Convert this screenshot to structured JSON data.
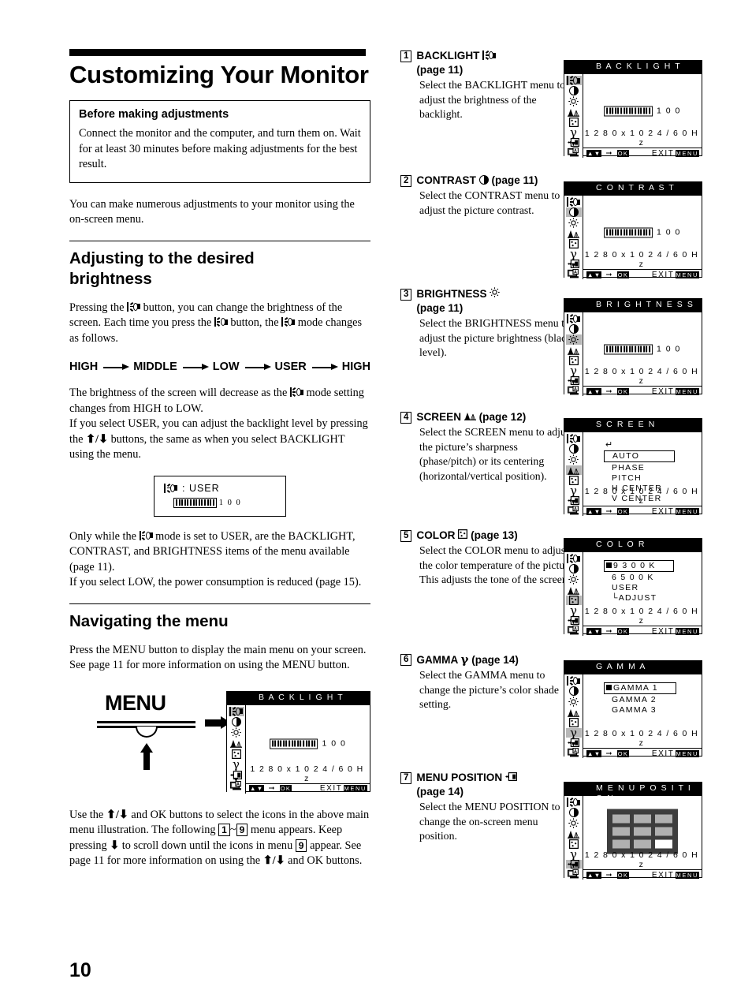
{
  "page_number": "10",
  "left": {
    "title": "Customizing Your Monitor",
    "note": {
      "heading": "Before making adjustments",
      "body": "Connect the monitor and the computer, and turn them on. Wait for at least 30 minutes before making adjustments for the best result."
    },
    "intro": "You can make numerous adjustments to your monitor using the on-screen menu.",
    "section1": {
      "title_line1": "Adjusting to the desired",
      "title_line2": "brightness",
      "para1": "Pressing the   button, you can change the brightness of the screen. Each time you press the   button, the   mode changes as follows.",
      "flow": [
        "HIGH",
        "MIDDLE",
        "LOW",
        "USER",
        "HIGH"
      ],
      "para2_a": "The brightness of the screen will decrease as the",
      "para2_b": "mode setting changes from HIGH to LOW.",
      "para2_c": "If you select USER, you can adjust the backlight level by pressing the",
      "para2_d": "buttons, the same as when you select BACKLIGHT using the menu.",
      "user_box": {
        "label": ": USER",
        "value": "1 0 0"
      },
      "para3_a": "Only while the",
      "para3_b": "mode is set to USER, are the BACKLIGHT, CONTRAST, and BRIGHTNESS items of the menu available (page 11).",
      "para3_c": "If you select LOW, the power consumption is reduced (page 15)."
    },
    "section2": {
      "title": "Navigating the menu",
      "para1": "Press the MENU button to display the main menu on your screen. See page 11 for more information on using the MENU button.",
      "menu_word": "MENU",
      "footer_a": "Use the",
      "footer_b": "and OK buttons to select the icons in the above main menu illustration. The following",
      "footer_c": "~",
      "footer_d": "menu appears. Keep pressing",
      "footer_e": "to scroll down until the icons in menu",
      "footer_f": "appear. See page 11 for more information on using the",
      "footer_g": "and OK buttons.",
      "num1": "1",
      "num9": "9",
      "num9b": "9"
    }
  },
  "osd_common": {
    "resolution": "1 2 8 0 x 1 0 2 4 / 6 0 H z",
    "bar_ok": "OK",
    "bar_exit": "EXIT",
    "bar_menu": "MENU",
    "scroll_down": "↓",
    "icons": [
      "backlight-icon",
      "contrast-icon",
      "brightness-icon",
      "screen-icon",
      "color-icon",
      "gamma-icon",
      "menu-position-icon",
      "language-icon"
    ]
  },
  "items": [
    {
      "num": "1",
      "heading": "BACKLIGHT",
      "page": "(page 11)",
      "body": "Select the BACKLIGHT menu to adjust the brightness of the backlight.",
      "icon": "backlight-icon",
      "osd": {
        "title": "BACKLIGHT",
        "type": "slider",
        "value": "1 0 0",
        "selected_index": 0
      }
    },
    {
      "num": "2",
      "heading": "CONTRAST",
      "page": "(page 11)",
      "body": "Select the CONTRAST menu to adjust the picture contrast.",
      "icon": "contrast-icon",
      "osd": {
        "title": "CONTRAST",
        "type": "slider",
        "value": "1 0 0",
        "selected_index": 1
      }
    },
    {
      "num": "3",
      "heading": "BRIGHTNESS",
      "page": "(page 11)",
      "body": "Select the BRIGHTNESS menu to adjust the picture brightness (black level).",
      "icon": "brightness-icon",
      "osd": {
        "title": "BRIGHTNESS",
        "type": "slider",
        "value": "1 0 0",
        "selected_index": 2
      }
    },
    {
      "num": "4",
      "heading": "SCREEN",
      "page": "(page 12)",
      "body": "Select the SCREEN menu to adjust the picture’s sharpness (phase/pitch) or its centering (horizontal/vertical position).",
      "icon": "screen-icon",
      "osd": {
        "title": "SCREEN",
        "type": "list",
        "selected_index": 3,
        "back_arrow": true,
        "entries": [
          {
            "label": "AUTO",
            "boxed": true,
            "mark": false
          },
          {
            "label": "PHASE",
            "boxed": false,
            "mark": false
          },
          {
            "label": "PITCH",
            "boxed": false,
            "mark": false
          },
          {
            "label": "H CENTER",
            "boxed": false,
            "mark": false
          },
          {
            "label": "V CENTER",
            "boxed": false,
            "mark": false
          }
        ]
      }
    },
    {
      "num": "5",
      "heading": "COLOR",
      "page": "(page 13)",
      "body": "Select the COLOR menu to adjust the color temperature of the picture. This adjusts the tone of the screen.",
      "icon": "color-icon",
      "osd": {
        "title": "COLOR",
        "type": "list",
        "selected_index": 4,
        "back_arrow": false,
        "entries": [
          {
            "label": "9 3 0 0 K",
            "boxed": true,
            "mark": true
          },
          {
            "label": "6 5 0 0 K",
            "boxed": false,
            "mark": false
          },
          {
            "label": "USER",
            "boxed": false,
            "mark": false
          },
          {
            "label": "└ADJUST",
            "boxed": false,
            "mark": false
          }
        ]
      }
    },
    {
      "num": "6",
      "heading": "GAMMA",
      "page": "(page 14)",
      "body": "Select the GAMMA menu to change the picture’s color shade setting.",
      "icon": "gamma-icon",
      "osd": {
        "title": "GAMMA",
        "type": "list",
        "selected_index": 5,
        "back_arrow": false,
        "entries": [
          {
            "label": "GAMMA 1",
            "boxed": true,
            "mark": true
          },
          {
            "label": "GAMMA 2",
            "boxed": false,
            "mark": false
          },
          {
            "label": "GAMMA 3",
            "boxed": false,
            "mark": false
          }
        ]
      }
    },
    {
      "num": "7",
      "heading": "MENU POSITION",
      "page": "(page 14)",
      "body": "Select the MENU POSITION to change the on-screen menu position.",
      "icon": "menu-position-icon",
      "osd": {
        "title": "MENU POSITION",
        "type": "grid",
        "selected_index": 6,
        "grid_selected_cell": 8
      }
    }
  ],
  "main_menu_illustration": {
    "osd": {
      "title": "BACKLIGHT",
      "type": "slider",
      "value": "1 0 0",
      "selected_index": 0
    }
  }
}
